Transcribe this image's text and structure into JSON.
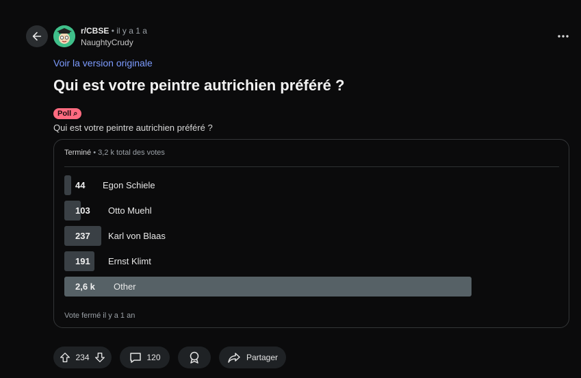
{
  "header": {
    "subreddit": "r/CBSE",
    "time": "• il y a 1 a",
    "username": "NaughtyCrudy"
  },
  "post": {
    "original_link": "Voir la version originale",
    "title": "Qui est votre peintre autrichien préféré ?",
    "badge": "Poll ⌕",
    "question": "Qui est votre peintre autrichien préféré ?"
  },
  "poll": {
    "status": "Terminé",
    "total": "• 3,2 k total des votes",
    "options": [
      {
        "count": "44",
        "label": "Egon Schiele",
        "votes": 44
      },
      {
        "count": "103",
        "label": "Otto Muehl",
        "votes": 103
      },
      {
        "count": "237",
        "label": "Karl von Blaas",
        "votes": 237
      },
      {
        "count": "191",
        "label": "Ernst Klimt",
        "votes": 191
      },
      {
        "count": "2,6 k",
        "label": "Other",
        "votes": 2600
      }
    ],
    "closed": "Vote fermé il y a 1 an"
  },
  "actions": {
    "votes": "234",
    "comments": "120",
    "share": "Partager"
  },
  "colors": {
    "background": "#0b0b0c",
    "link": "#7d9cff",
    "poll_badge": "#ff6b80",
    "bar": "#3a4045",
    "bar_winner": "#566166"
  }
}
